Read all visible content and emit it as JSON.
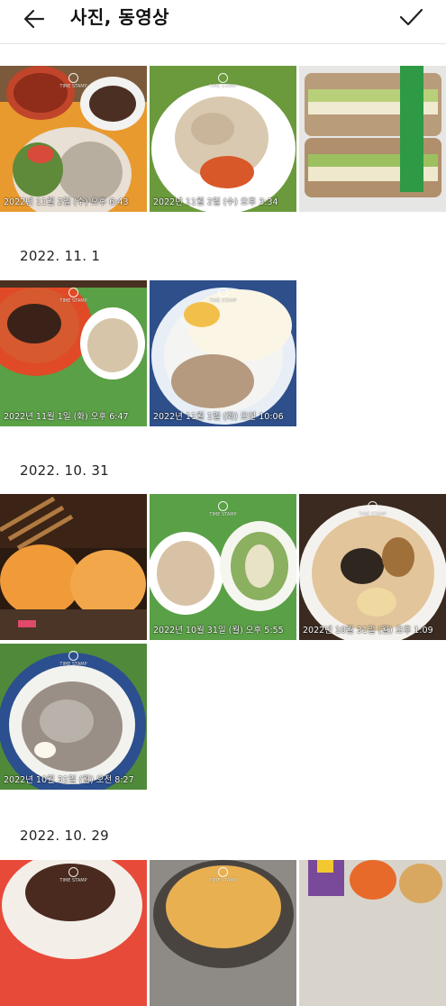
{
  "header": {
    "title": "사진, 동영상",
    "back_icon": "arrow-left-icon",
    "confirm_icon": "checkmark-icon"
  },
  "watermark": "TIME STAMP",
  "groups": [
    {
      "date": "",
      "photos": [
        {
          "stamp": "2022년 11월 2일 (수) 오후 6:43"
        },
        {
          "stamp": "2022년 11월 2일 (수) 오후 3:34"
        },
        {
          "stamp": ""
        }
      ]
    },
    {
      "date": "2022. 11. 1",
      "photos": [
        {
          "stamp": "2022년 11월 1일 (화) 오후 6:47"
        },
        {
          "stamp": "2022년 11월 1일 (화) 오전 10:06"
        }
      ]
    },
    {
      "date": "2022. 10. 31",
      "photos": [
        {
          "stamp": ""
        },
        {
          "stamp": "2022년 10월 31일 (월) 오후 5:55"
        },
        {
          "stamp": "2022년 10월 31일 (월) 오후 1:09"
        },
        {
          "stamp": "2022년 10월 31일 (월) 오전 8:27"
        }
      ]
    },
    {
      "date": "2022. 10. 29",
      "photos": [
        {
          "stamp": ""
        },
        {
          "stamp": ""
        },
        {
          "stamp": ""
        }
      ]
    }
  ]
}
